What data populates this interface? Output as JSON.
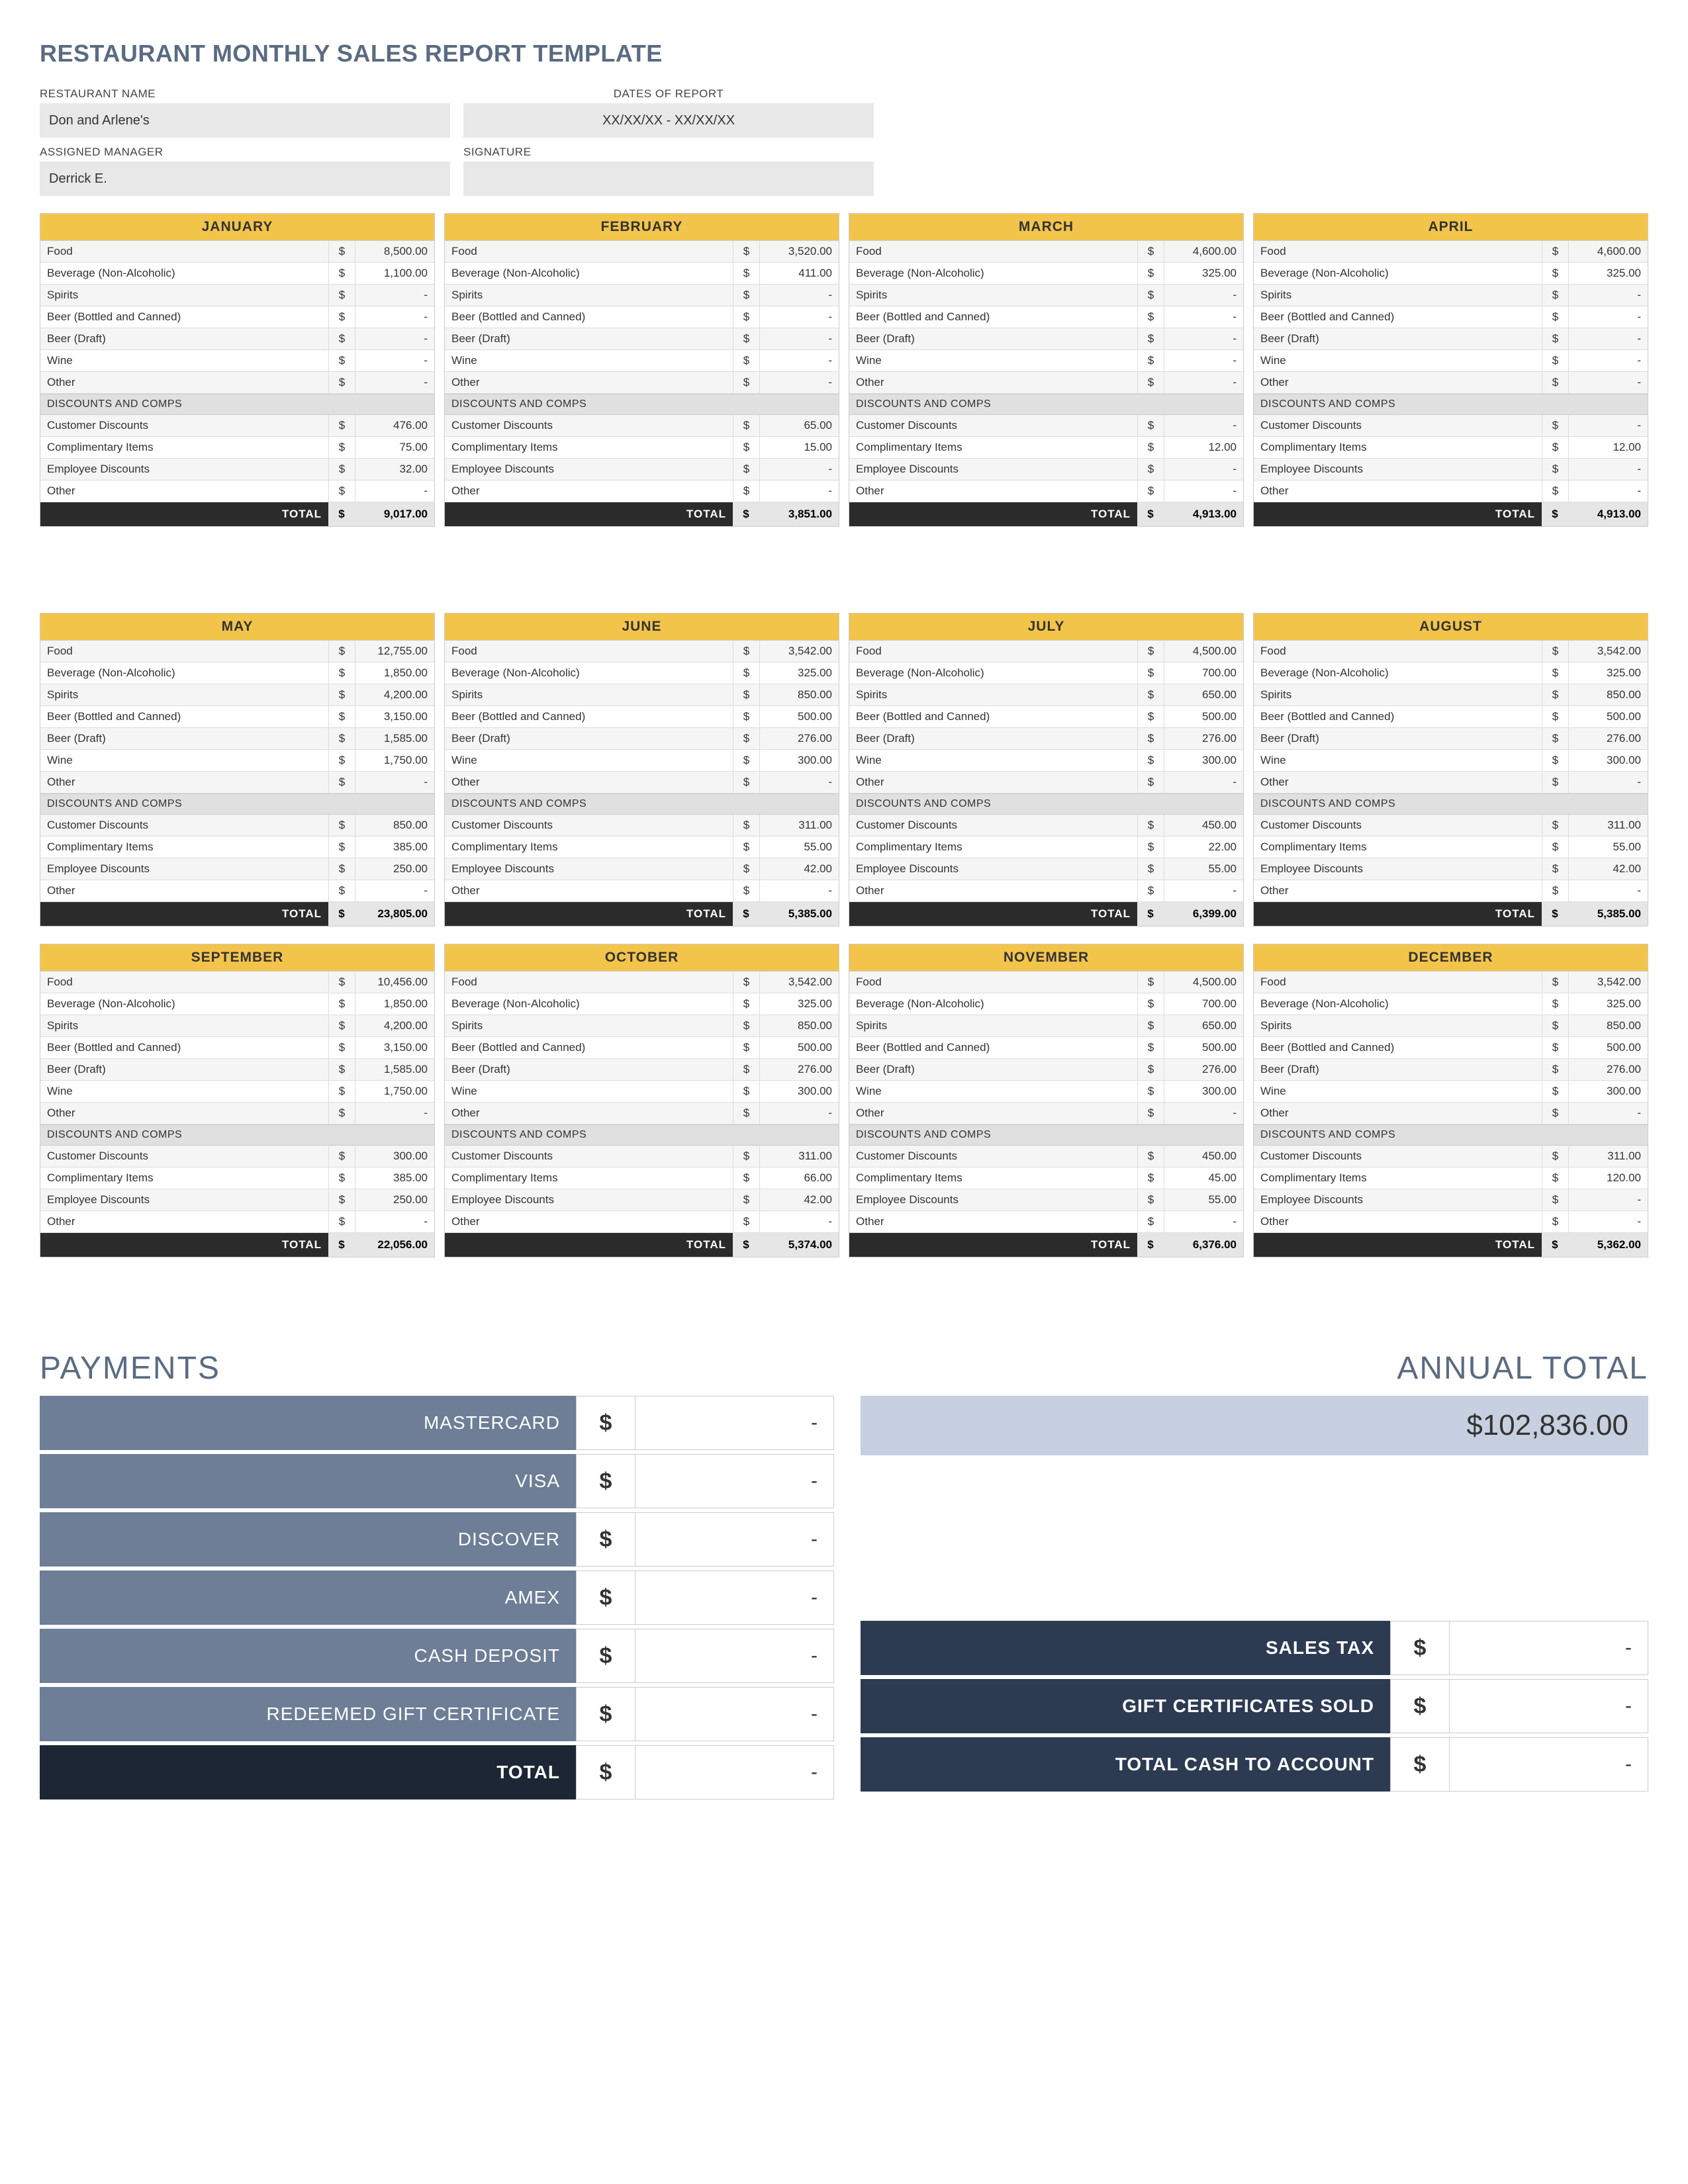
{
  "title": "RESTAURANT MONTHLY SALES REPORT TEMPLATE",
  "header": {
    "restaurant_label": "RESTAURANT NAME",
    "restaurant_value": "Don and Arlene's",
    "dates_label": "DATES OF REPORT",
    "dates_value": "XX/XX/XX - XX/XX/XX",
    "manager_label": "ASSIGNED MANAGER",
    "manager_value": "Derrick E.",
    "signature_label": "SIGNATURE",
    "signature_value": ""
  },
  "rev_labels": [
    "Food",
    "Beverage (Non-Alcoholic)",
    "Spirits",
    "Beer (Bottled and Canned)",
    "Beer (Draft)",
    "Wine",
    "Other"
  ],
  "disc_header": "DISCOUNTS AND COMPS",
  "disc_labels": [
    "Customer Discounts",
    "Complimentary Items",
    "Employee Discounts",
    "Other"
  ],
  "total_label": "TOTAL",
  "currency": "$",
  "months": [
    {
      "name": "JANUARY",
      "rev": [
        "8,500.00",
        "1,100.00",
        "-",
        "-",
        "-",
        "-",
        "-"
      ],
      "disc": [
        "476.00",
        "75.00",
        "32.00",
        "-"
      ],
      "total": "9,017.00"
    },
    {
      "name": "FEBRUARY",
      "rev": [
        "3,520.00",
        "411.00",
        "-",
        "-",
        "-",
        "-",
        "-"
      ],
      "disc": [
        "65.00",
        "15.00",
        "-",
        "-"
      ],
      "total": "3,851.00"
    },
    {
      "name": "MARCH",
      "rev": [
        "4,600.00",
        "325.00",
        "-",
        "-",
        "-",
        "-",
        "-"
      ],
      "disc": [
        "-",
        "12.00",
        "-",
        "-"
      ],
      "total": "4,913.00"
    },
    {
      "name": "APRIL",
      "rev": [
        "4,600.00",
        "325.00",
        "-",
        "-",
        "-",
        "-",
        "-"
      ],
      "disc": [
        "-",
        "12.00",
        "-",
        "-"
      ],
      "total": "4,913.00"
    },
    {
      "name": "MAY",
      "rev": [
        "12,755.00",
        "1,850.00",
        "4,200.00",
        "3,150.00",
        "1,585.00",
        "1,750.00",
        "-"
      ],
      "disc": [
        "850.00",
        "385.00",
        "250.00",
        "-"
      ],
      "total": "23,805.00"
    },
    {
      "name": "JUNE",
      "rev": [
        "3,542.00",
        "325.00",
        "850.00",
        "500.00",
        "276.00",
        "300.00",
        "-"
      ],
      "disc": [
        "311.00",
        "55.00",
        "42.00",
        "-"
      ],
      "total": "5,385.00"
    },
    {
      "name": "JULY",
      "rev": [
        "4,500.00",
        "700.00",
        "650.00",
        "500.00",
        "276.00",
        "300.00",
        "-"
      ],
      "disc": [
        "450.00",
        "22.00",
        "55.00",
        "-"
      ],
      "total": "6,399.00"
    },
    {
      "name": "AUGUST",
      "rev": [
        "3,542.00",
        "325.00",
        "850.00",
        "500.00",
        "276.00",
        "300.00",
        "-"
      ],
      "disc": [
        "311.00",
        "55.00",
        "42.00",
        "-"
      ],
      "total": "5,385.00"
    },
    {
      "name": "SEPTEMBER",
      "rev": [
        "10,456.00",
        "1,850.00",
        "4,200.00",
        "3,150.00",
        "1,585.00",
        "1,750.00",
        "-"
      ],
      "disc": [
        "300.00",
        "385.00",
        "250.00",
        "-"
      ],
      "total": "22,056.00"
    },
    {
      "name": "OCTOBER",
      "rev": [
        "3,542.00",
        "325.00",
        "850.00",
        "500.00",
        "276.00",
        "300.00",
        "-"
      ],
      "disc": [
        "311.00",
        "66.00",
        "42.00",
        "-"
      ],
      "total": "5,374.00"
    },
    {
      "name": "NOVEMBER",
      "rev": [
        "4,500.00",
        "700.00",
        "650.00",
        "500.00",
        "276.00",
        "300.00",
        "-"
      ],
      "disc": [
        "450.00",
        "45.00",
        "55.00",
        "-"
      ],
      "total": "6,376.00"
    },
    {
      "name": "DECEMBER",
      "rev": [
        "3,542.00",
        "325.00",
        "850.00",
        "500.00",
        "276.00",
        "300.00",
        "-"
      ],
      "disc": [
        "311.00",
        "120.00",
        "-",
        "-"
      ],
      "total": "5,362.00"
    }
  ],
  "payments": {
    "title": "PAYMENTS",
    "rows": [
      {
        "label": "MASTERCARD",
        "value": "-"
      },
      {
        "label": "VISA",
        "value": "-"
      },
      {
        "label": "DISCOVER",
        "value": "-"
      },
      {
        "label": "AMEX",
        "value": "-"
      },
      {
        "label": "CASH DEPOSIT",
        "value": "-"
      },
      {
        "label": "REDEEMED GIFT CERTIFICATE",
        "value": "-"
      }
    ],
    "total_label": "TOTAL",
    "total_value": "-"
  },
  "annual": {
    "title": "ANNUAL TOTAL",
    "value": "$102,836.00"
  },
  "summary": [
    {
      "label": "SALES TAX",
      "value": "-"
    },
    {
      "label": "GIFT CERTIFICATES SOLD",
      "value": "-"
    },
    {
      "label": "TOTAL CASH TO ACCOUNT",
      "value": "-"
    }
  ]
}
